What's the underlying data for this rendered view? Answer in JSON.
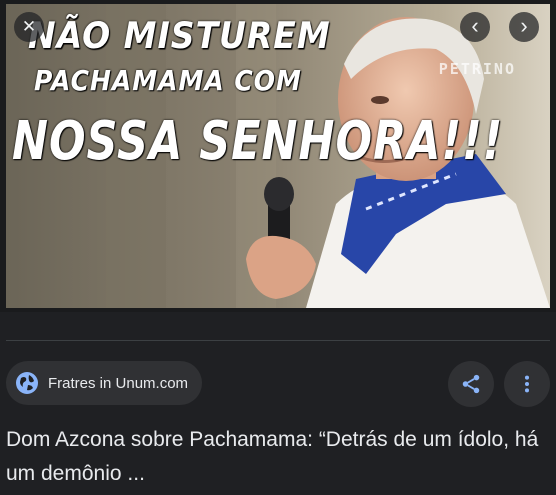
{
  "image": {
    "caption_line1": "NÃO MISTUREM",
    "caption_line2": "PACHAMAMA COM",
    "caption_line3": "NOSSA SENHORA!!!",
    "watermark": "PETRINO"
  },
  "controls": {
    "close_icon": "✕",
    "prev_icon": "‹",
    "next_icon": "›"
  },
  "source": {
    "name": "Fratres in Unum.com",
    "icon": "globe-icon"
  },
  "actions": {
    "share_icon": "share-icon",
    "more_icon": "more-vert-icon"
  },
  "result": {
    "title": "Dom Azcona sobre Pachamama: “Detrás de um ídolo, há um demônio ..."
  },
  "colors": {
    "background": "#1f2023",
    "chip": "#303134",
    "accent": "#8ab4f8",
    "text": "#e8eaed"
  }
}
